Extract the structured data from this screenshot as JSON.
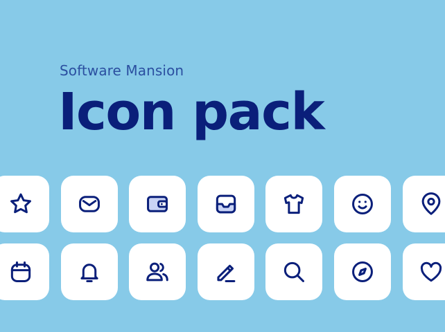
{
  "brand": "Software Mansion",
  "title": "Icon pack",
  "colors": {
    "background": "#87CAE8",
    "tile": "#FFFFFF",
    "text": "#0A1F7A",
    "brand_text": "#2B4FA0",
    "icon_stroke": "#0A1F7A",
    "icon_fill_accent": "#C9D3F5"
  },
  "icons": {
    "row1": [
      "star-icon",
      "envelope-icon",
      "wallet-icon",
      "inbox-tray-icon",
      "tshirt-icon",
      "smiley-icon",
      "location-pin-icon"
    ],
    "row2": [
      "calendar-icon",
      "bell-icon",
      "users-icon",
      "pencil-icon",
      "search-icon",
      "compass-icon",
      "heart-icon"
    ]
  }
}
